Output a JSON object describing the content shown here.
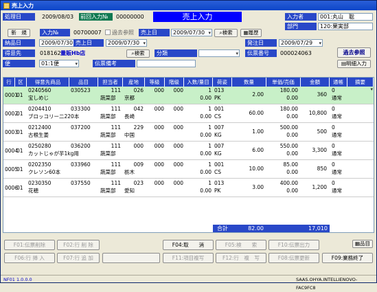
{
  "window": {
    "title": "売上入力"
  },
  "header": {
    "label_process_date": "処理日",
    "process_date": "2009/08/03",
    "label_prev_no": "前回入力№",
    "prev_no": "00000000",
    "screen_title": "売上入力",
    "label_inputter": "入力者",
    "inputter": "001:丸山　聡",
    "label_dept": "部門",
    "dept": "120:果実部"
  },
  "row2": {
    "new_button": "新　規",
    "label_input_no": "入力№",
    "input_no": "00700007",
    "past_ref_check": "過去参照",
    "label_sales_date": "売上日",
    "sales_date": "2009/07/30",
    "search": "検索",
    "history": "履歴"
  },
  "row3": {
    "label_delivery": "納品日",
    "delivery": "2009/07/30",
    "label_sales": "売上日",
    "sales": "2009/07/30",
    "label_ship": "発注日",
    "ship": "2009/07/29"
  },
  "row4": {
    "label_customer": "得意先",
    "customer_code": "018162",
    "customer_name": "量販Hb店",
    "search": "検索",
    "label_category": "分類",
    "label_slip": "伝票番号",
    "slip_no": "000024063",
    "past_ref_button": "過去参照"
  },
  "row5": {
    "label_flight": "便",
    "flight": "01:1便",
    "label_note": "伝票備考",
    "detail_input": "明細入力"
  },
  "grid": {
    "headers": [
      "行",
      "区",
      "得意先商品",
      "品目",
      "担当者",
      "産地",
      "等級",
      "階級",
      "入数/量目",
      "荷姿",
      "数量",
      "単価/売価",
      "金額",
      "通帳",
      "摘要"
    ],
    "rows": [
      {
        "line": "0001",
        "kbn": "01",
        "code": "0240560",
        "item": "030523",
        "name": "宝しめじ",
        "staff": "111",
        "area": "026",
        "area_name": "京都",
        "grade": "000",
        "cls": "000",
        "qty_unit": "1",
        "qty_unit2": "0.00",
        "pkg": "013",
        "pkg2": "PK",
        "qty": "2.00",
        "price": "180.00",
        "price2": "0.00",
        "amount": "360",
        "tsu": "0",
        "tsu2": "通常",
        "dept": "蔬菜部"
      },
      {
        "line": "0002",
        "kbn": "01",
        "code": "0204410",
        "item": "033300",
        "name": "ブロッコリー二220本",
        "staff": "111",
        "area": "042",
        "area_name": "長崎",
        "grade": "000",
        "cls": "000",
        "qty_unit": "1",
        "qty_unit2": "0.00",
        "pkg": "001",
        "pkg2": "CS",
        "qty": "60.00",
        "price": "180.00",
        "price2": "0.00",
        "amount": "10,800",
        "tsu": "0",
        "tsu2": "通常",
        "dept": "蔬菜部"
      },
      {
        "line": "0003",
        "kbn": "01",
        "code": "0212400",
        "item": "037200",
        "name": "古根生姜",
        "staff": "111",
        "area": "229",
        "area_name": "中国",
        "grade": "000",
        "cls": "000",
        "qty_unit": "1",
        "qty_unit2": "0.00",
        "pkg": "007",
        "pkg2": "KG",
        "qty": "1.00",
        "price": "500.00",
        "price2": "0.00",
        "amount": "500",
        "tsu": "0",
        "tsu2": "通常",
        "dept": "蔬菜部"
      },
      {
        "line": "0004",
        "kbn": "01",
        "code": "0250280",
        "item": "036200",
        "name": "カットじゃが芋1kg用",
        "staff": "111",
        "area": "000",
        "area_name": "",
        "grade": "000",
        "cls": "000",
        "qty_unit": "1",
        "qty_unit2": "0.00",
        "pkg": "007",
        "pkg2": "KG",
        "qty": "6.00",
        "price": "550.00",
        "price2": "0.00",
        "amount": "3,300",
        "tsu": "0",
        "tsu2": "通常",
        "dept": "蔬菜部"
      },
      {
        "line": "0005",
        "kbn": "01",
        "code": "0202350",
        "item": "033960",
        "name": "クレソン60本",
        "staff": "111",
        "area": "009",
        "area_name": "栃木",
        "grade": "000",
        "cls": "000",
        "qty_unit": "1",
        "qty_unit2": "0.00",
        "pkg": "001",
        "pkg2": "CS",
        "qty": "10.00",
        "price": "85.00",
        "price2": "0.00",
        "amount": "850",
        "tsu": "0",
        "tsu2": "通常",
        "dept": "蔬菜部"
      },
      {
        "line": "0006",
        "kbn": "01",
        "code": "0230350",
        "item": "037550",
        "name": "花穂",
        "staff": "111",
        "area": "023",
        "area_name": "愛知",
        "grade": "000",
        "cls": "000",
        "qty_unit": "1",
        "qty_unit2": "0.00",
        "pkg": "013",
        "pkg2": "PK",
        "qty": "3.00",
        "price": "400.00",
        "price2": "0.00",
        "amount": "1,200",
        "tsu": "0",
        "tsu2": "通常",
        "dept": "蔬菜部"
      }
    ],
    "total_label": "合計",
    "total_qty": "82.00",
    "total_amount": "17,010"
  },
  "buttons": {
    "item": "品目",
    "f01": "F01:伝票削除",
    "f02": "F02:行 削 除",
    "f04": "F04:取　　消",
    "f05": "F05:検　　索",
    "f10": "F10:伝票出力",
    "f06": "F06:行 挿 入",
    "f07": "F07:行 追 加",
    "f11": "F11:項目複写",
    "f12": "F12:行　複　写",
    "f08": "F08:伝票更新",
    "f09": "F09:業務終了"
  },
  "status": {
    "left": "NF01  1.0.0.0",
    "right": "SAAS.OHYA.INTELLIENOVO-FAC9FC8"
  }
}
